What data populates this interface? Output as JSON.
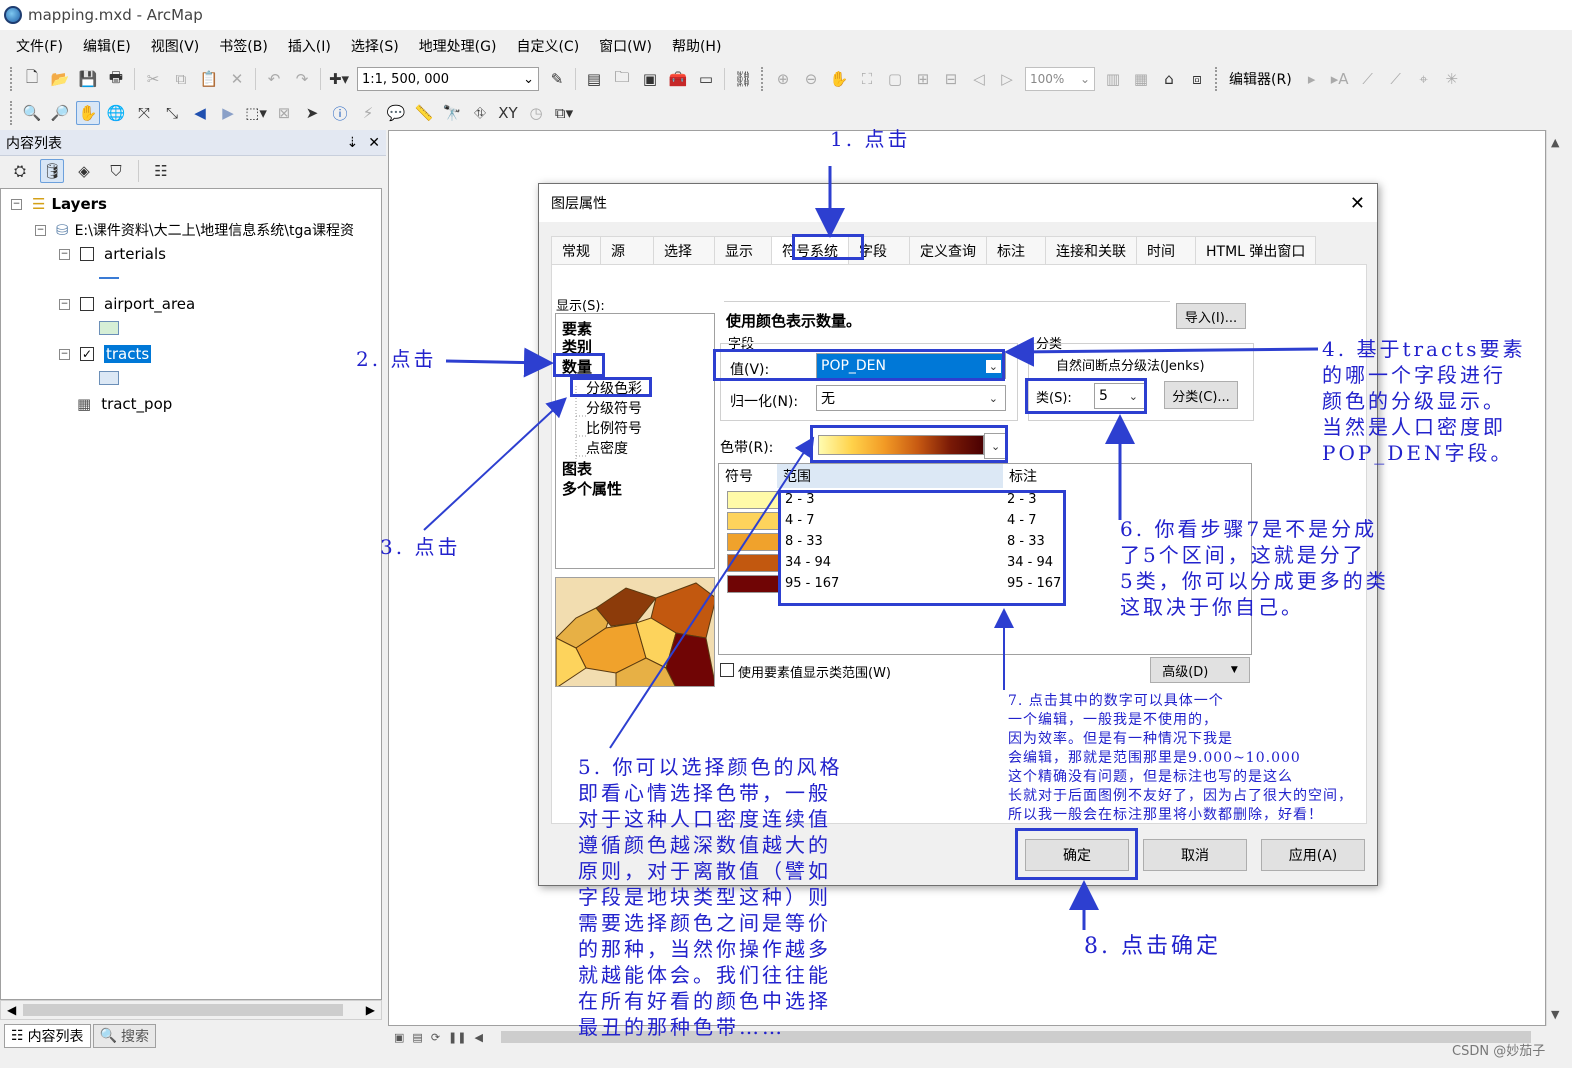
{
  "window": {
    "title": "mapping.mxd - ArcMap"
  },
  "menu": [
    "文件(F)",
    "编辑(E)",
    "视图(V)",
    "书签(B)",
    "插入(I)",
    "选择(S)",
    "地理处理(G)",
    "自定义(C)",
    "窗口(W)",
    "帮助(H)"
  ],
  "toolbar": {
    "scale": "1:1, 500, 000",
    "zoom": "100%",
    "editor": "编辑器(R)"
  },
  "toc": {
    "title": "内容列表",
    "layers_label": "Layers",
    "path": "E:\\课件资料\\大二上\\地理信息系统\\tga课程资",
    "items": [
      {
        "name": "arterials",
        "checked": false
      },
      {
        "name": "airport_area",
        "checked": false
      },
      {
        "name": "tracts",
        "checked": true
      },
      {
        "name": "tract_pop"
      }
    ],
    "tabs": [
      "内容列表",
      "搜索"
    ]
  },
  "dialog": {
    "title": "图层属性",
    "tabs": [
      "常规",
      "源",
      "选择",
      "显示",
      "符号系统",
      "字段",
      "定义查询",
      "标注",
      "连接和关联",
      "时间",
      "HTML 弹出窗口"
    ],
    "active_tab": "符号系统",
    "show_label": "显示(S):",
    "show_list": {
      "features": "要素",
      "categories": "类别",
      "quantities": "数量",
      "graduated_colors": "分级色彩",
      "graduated_symbols": "分级符号",
      "proportional_symbols": "比例符号",
      "dot_density": "点密度",
      "charts": "图表",
      "multiple_attributes": "多个属性"
    },
    "description": "使用颜色表示数量。",
    "import_button": "导入(I)...",
    "field_group": "字段",
    "value_label": "值(V):",
    "value": "POP_DEN",
    "normalization_label": "归一化(N):",
    "normalization": "无",
    "classification_group": "分类",
    "method": "自然间断点分级法(Jenks)",
    "classes_label": "类(S):",
    "classes": "5",
    "classify_button": "分类(C)...",
    "color_ramp_label": "色带(R):",
    "table_headers": {
      "symbol": "符号",
      "range": "范围",
      "label": "标注"
    },
    "classes_table": [
      {
        "range": "2 - 3",
        "label": "2 - 3",
        "color": "#fffaa8"
      },
      {
        "range": "4 - 7",
        "label": "4 - 7",
        "color": "#fdd35c"
      },
      {
        "range": "8 - 33",
        "label": "8 - 33",
        "color": "#f0a22c"
      },
      {
        "range": "34 - 94",
        "label": "34 - 94",
        "color": "#c2580f"
      },
      {
        "range": "95 - 167",
        "label": "95 - 167",
        "color": "#700505"
      }
    ],
    "use_feature_values": "使用要素值显示类范围(W)",
    "advanced_button": "高级(D)",
    "ok_button": "确定",
    "cancel_button": "取消",
    "apply_button": "应用(A)"
  },
  "annotations": {
    "a1": "1. 点击",
    "a2": "2. 点击",
    "a3": "3. 点击",
    "a4": "4. 基于tracts要素\n的哪一个字段进行\n颜色的分级显示。\n当然是人口密度即\nPOP_DEN字段。",
    "a5": "5. 你可以选择颜色的风格\n即看心情选择色带，一般\n对于这种人口密度连续值\n遵循颜色越深数值越大的\n原则，对于离散值（譬如\n字段是地块类型这种）则\n需要选择颜色之间是等价\n的那种，当然你操作越多\n就越能体会。我们往往能\n在所有好看的颜色中选择\n最丑的那种色带……",
    "a6": "6. 你看步骤7是不是分成\n了5个区间，这就是分了\n5类，你可以分成更多的类\n这取决于你自己。",
    "a7": "7. 点击其中的数字可以具体一个\n一个编辑，一般我是不使用的，\n因为效率。但是有一种情况下我是\n会编辑，那就是范围那里是9.000~10.000\n这个精确没有问题，但是标注也写的是这么\n长就对于后面图例不友好了，因为占了很大的空间，\n所以我一般会在标注那里将小数都删除，好看！",
    "a8": "8. 点击确定"
  },
  "watermark": "CSDN @妙茄子",
  "colors": {
    "annotation": "#2222cc",
    "highlight_box": "#2d3fd0",
    "selection": "#0078d7"
  }
}
